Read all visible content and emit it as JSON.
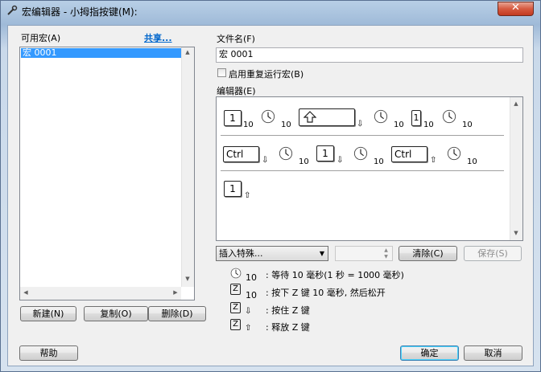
{
  "window": {
    "title": "宏编辑器 - 小拇指按键(M):",
    "close_label": "✕"
  },
  "macros_panel": {
    "label": "可用宏(A)",
    "share_link": "共享...",
    "items": [
      "宏 0001"
    ],
    "new_button": "新建(N)",
    "copy_button": "复制(O)",
    "delete_button": "删除(D)"
  },
  "file": {
    "label": "文件名(F)",
    "value": "宏 0001"
  },
  "repeat": {
    "label": "启用重复运行宏(B)",
    "checked": false
  },
  "editor": {
    "label": "编辑器(E)",
    "row1": {
      "k1": "1",
      "s1": "10",
      "s2": "10",
      "s3": "10",
      "s4": "1",
      "s5": "10",
      "s6": "10"
    },
    "row2": {
      "ctrl1": "Ctrl",
      "s1": "10",
      "k1": "1",
      "s2": "10",
      "ctrl2": "Ctrl",
      "s3": "10"
    },
    "row3": {
      "k1": "1"
    }
  },
  "controls": {
    "insert_special": "插入特殊...",
    "clear_button": "清除(C)",
    "save_button": "保存(S)"
  },
  "legend": {
    "l1": {
      "num": "10",
      "text": ": 等待 10 毫秒(1 秒 = 1000 毫秒)"
    },
    "l2": {
      "key": "Z",
      "num": "10",
      "text": ": 按下 Z 键 10 毫秒, 然后松开"
    },
    "l3": {
      "key": "Z",
      "text": ": 按住 Z 键"
    },
    "l4": {
      "key": "Z",
      "text": ": 释放 Z 键"
    }
  },
  "footer": {
    "help_button": "帮助",
    "ok_button": "确定",
    "cancel_button": "取消"
  },
  "colors": {
    "selection": "#3399ff",
    "link": "#0066cc",
    "close": "#c23a20"
  }
}
